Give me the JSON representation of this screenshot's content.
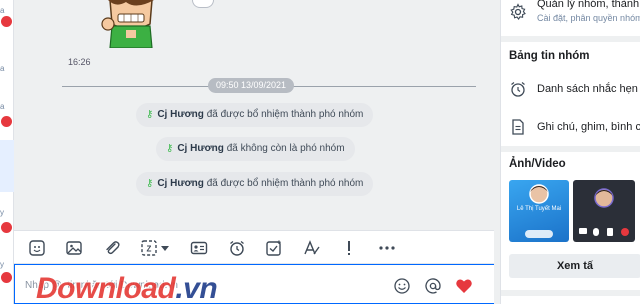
{
  "chat": {
    "message_time": "16:26",
    "date_separator": "09:50 13/09/2021",
    "notices": [
      {
        "who": "Cj Hương",
        "text": "đã được bổ nhiệm thành phó nhóm"
      },
      {
        "who": "Cj Hương",
        "text": "đã không còn là phó nhóm"
      },
      {
        "who": "Cj Hương",
        "text": "đã được bổ nhiệm thành phó nhóm"
      }
    ],
    "sticker": "boy-grinning-sticker"
  },
  "toolbar": {
    "icons": [
      "sticker-icon",
      "image-icon",
      "attach-icon",
      "screenshot-icon",
      "dropdown-caret-icon",
      "contact-card-icon",
      "reminder-clock-icon",
      "task-check-icon",
      "text-format-icon",
      "important-icon",
      "more-icon"
    ]
  },
  "composer": {
    "placeholder": "Nhập @, tin nhắn tới Download.vn",
    "value": ""
  },
  "watermark": {
    "main": "Download",
    "suffix": ".vn"
  },
  "panel": {
    "manage": {
      "title": "Quản lý nhóm, thành",
      "subtitle": "Cài đặt, phân quyền nhóm"
    },
    "board_title": "Bảng tin nhóm",
    "reminders": "Danh sách nhắc hẹn",
    "notes": "Ghi chú, ghim, bình c",
    "media_title": "Ảnh/Video",
    "thumb_name": "Lê Thị Tuyết Mai",
    "see_all": "Xem tấ"
  },
  "colors": {
    "accent": "#0068ff",
    "key_icon": "#3dba4e",
    "heart": "#e6383e",
    "chat_bg": "#eef0f1"
  }
}
